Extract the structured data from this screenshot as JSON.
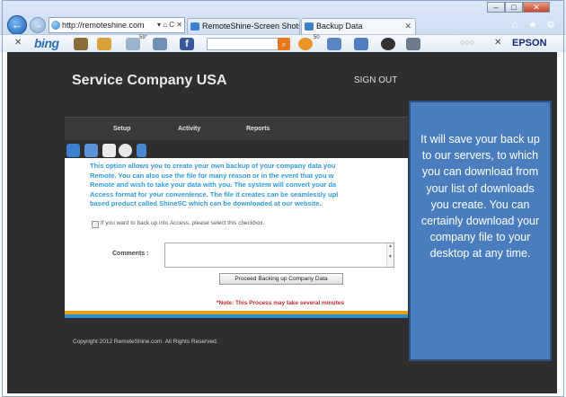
{
  "browser": {
    "address": "http://remoteshine.com",
    "address_tools": "▾ ⌂ C ✕",
    "tabs": [
      {
        "label": "RemoteShine-Screen Shots"
      },
      {
        "label": "Backup Data"
      }
    ],
    "toolbar": {
      "bing_label": "bing",
      "badge_59": "59°",
      "badge_50": "50",
      "epson_label": "EPSON"
    }
  },
  "site": {
    "title": "Service Company USA",
    "signout": "SIGN OUT",
    "nav": [
      {
        "label": "Setup"
      },
      {
        "label": "Activity"
      },
      {
        "label": "Reports"
      }
    ]
  },
  "backup": {
    "info_lines": [
      "This option allows you to create your own backup of your company data you",
      "Remote. You can also use the file for many reason or in the event that you w",
      "Remote and wish to take your data with you. The system will convert your da",
      "Access format for your convenience. The file it creates can be seamlessly upl",
      "based product called ShineSC which can be downloaded at our website."
    ],
    "checkbox_label": "If you want to back up into Access, please select this checkbox.",
    "comments_label": "Comments :",
    "comments_value": "",
    "proceed_button": "Proceed Backing up Company Data",
    "note": "*Note: This Process may take several minutes"
  },
  "footer": {
    "copyright": "Copyright 2012 RemoteShine.com. All Rights Reserved."
  },
  "callout": {
    "text": "It will save your back up to our servers, to which you can download from your list of downloads you create. You can certainly download your company file to your desktop at any time."
  },
  "colors": {
    "page_bg": "#2e2e2e",
    "info_text": "#2f9be0",
    "note_text": "#c0282a",
    "callout_bg": "#4a7dbd",
    "stripe_orange": "#e6a01c",
    "stripe_blue": "#2f8fc5"
  }
}
